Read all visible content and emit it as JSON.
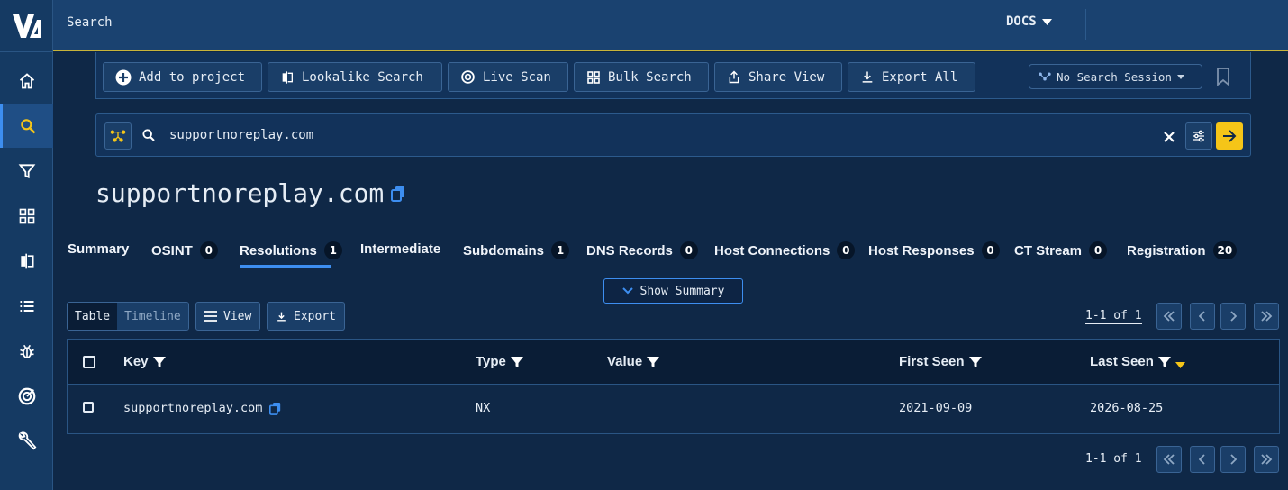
{
  "topbar": {
    "breadcrumb": "Search",
    "docs": "DOCS"
  },
  "sidebar": {
    "logo": "V",
    "items": [
      {
        "icon": "home-icon"
      },
      {
        "icon": "search-icon"
      },
      {
        "icon": "filter-icon"
      },
      {
        "icon": "grid-icon"
      },
      {
        "icon": "compare-icon"
      },
      {
        "icon": "list-icon"
      },
      {
        "icon": "bug-icon"
      },
      {
        "icon": "target-icon"
      },
      {
        "icon": "wrench-icon"
      }
    ]
  },
  "toolbar": {
    "add_to_project": "Add to project",
    "lookalike": "Lookalike Search",
    "live_scan": "Live Scan",
    "bulk_search": "Bulk Search",
    "share_view": "Share View",
    "export_all": "Export All",
    "session": "No Search Session"
  },
  "search": {
    "query": "supportnoreplay.com"
  },
  "heading": {
    "title": "supportnoreplay.com"
  },
  "tabs": [
    {
      "label": "Summary",
      "count": ""
    },
    {
      "label": "OSINT",
      "count": "0"
    },
    {
      "label": "Resolutions",
      "count": "1"
    },
    {
      "label": "Intermediate",
      "count": ""
    },
    {
      "label": "Subdomains",
      "count": "1"
    },
    {
      "label": "DNS Records",
      "count": "0"
    },
    {
      "label": "Host Connections",
      "count": "0"
    },
    {
      "label": "Host Responses",
      "count": "0"
    },
    {
      "label": "CT Stream",
      "count": "0"
    },
    {
      "label": "Registration",
      "count": "20"
    }
  ],
  "summary_button": "Show Summary",
  "view": {
    "table": "Table",
    "timeline": "Timeline",
    "view": "View",
    "export": "Export",
    "pager": "1-1 of 1"
  },
  "table": {
    "columns": [
      "Key",
      "Type",
      "Value",
      "First Seen",
      "Last Seen"
    ],
    "rows": [
      {
        "key": "supportnoreplay.com",
        "type": "NX",
        "value": "",
        "first_seen": "2021-09-09",
        "last_seen": "2026-08-25"
      }
    ]
  },
  "colors": {
    "accent": "#3d8ef0",
    "go": "#f5c518",
    "bg": "#0f2847"
  }
}
